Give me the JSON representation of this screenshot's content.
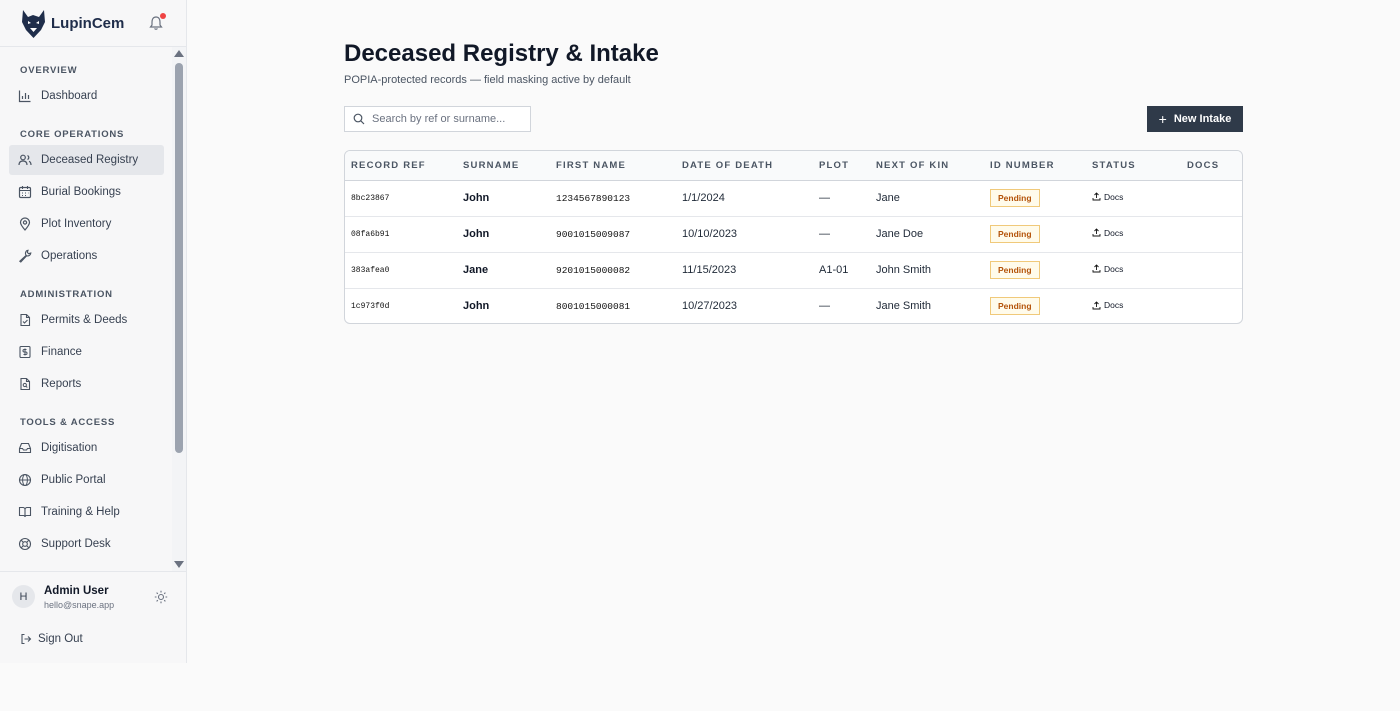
{
  "app": {
    "name": "LupinCem"
  },
  "sidebar": {
    "sections": [
      {
        "title": "Overview"
      },
      {
        "title": "Core Operations"
      },
      {
        "title": "Administration"
      },
      {
        "title": "Tools & Access"
      }
    ],
    "items": [
      {
        "label": "Dashboard",
        "icon": "chart-icon"
      },
      {
        "label": "Deceased Registry",
        "icon": "users-icon",
        "active": true
      },
      {
        "label": "Burial Bookings",
        "icon": "calendar-icon"
      },
      {
        "label": "Plot Inventory",
        "icon": "map-pin-icon"
      },
      {
        "label": "Operations",
        "icon": "wrench-icon"
      },
      {
        "label": "Permits & Deeds",
        "icon": "file-check-icon"
      },
      {
        "label": "Finance",
        "icon": "dollar-icon"
      },
      {
        "label": "Reports",
        "icon": "file-search-icon"
      },
      {
        "label": "Digitisation",
        "icon": "inbox-icon"
      },
      {
        "label": "Public Portal",
        "icon": "globe-icon"
      },
      {
        "label": "Training & Help",
        "icon": "book-icon"
      },
      {
        "label": "Support Desk",
        "icon": "lifebuoy-icon"
      }
    ]
  },
  "user": {
    "initial": "H",
    "name": "Admin User",
    "email": "hello@snape.app",
    "signout": "Sign Out"
  },
  "main": {
    "title": "Deceased Registry & Intake",
    "subtitle": "POPIA-protected records — field masking active by default",
    "search_placeholder": "Search by ref or surname...",
    "new_button": "New Intake",
    "columns": [
      "Record Ref",
      "Surname",
      "First Name",
      "Date of Death",
      "Plot",
      "Next of Kin",
      "ID Number",
      "Status",
      "Docs"
    ],
    "rows": [
      {
        "ref": "8bc23867",
        "surname": "John",
        "first_name": "1234567890123",
        "dod": "1/1/2024",
        "plot": "—",
        "kin": "Jane",
        "id_number": "",
        "status": "Pending",
        "docs": "Docs"
      },
      {
        "ref": "08fa6b91",
        "surname": "John",
        "first_name": "9001015009087",
        "dod": "10/10/2023",
        "plot": "—",
        "kin": "Jane Doe",
        "id_number": "",
        "status": "Pending",
        "docs": "Docs"
      },
      {
        "ref": "383afea0",
        "surname": "Jane",
        "first_name": "9201015000082",
        "dod": "11/15/2023",
        "plot": "A1-01",
        "kin": "John Smith",
        "id_number": "",
        "status": "Pending",
        "docs": "Docs"
      },
      {
        "ref": "1c973f0d",
        "surname": "John",
        "first_name": "8001015000081",
        "dod": "10/27/2023",
        "plot": "—",
        "kin": "Jane Smith",
        "id_number": "",
        "status": "Pending",
        "docs": "Docs"
      }
    ]
  },
  "colors": {
    "accent": "#2f3a49",
    "badge_text": "#b45309",
    "badge_bg": "#fffbeb",
    "notification": "#ef4444"
  }
}
